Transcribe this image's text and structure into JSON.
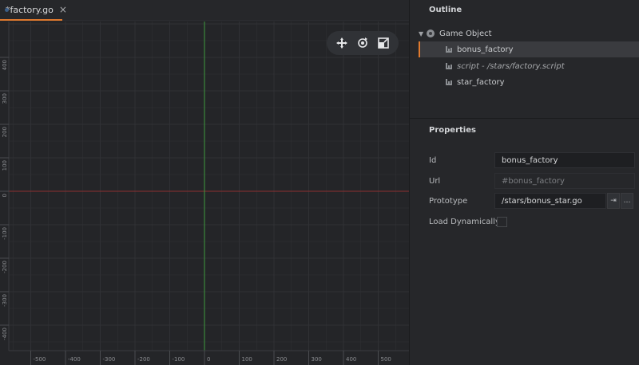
{
  "tab": {
    "title": "*factory.go",
    "close": "×",
    "icon": "game-object-icon"
  },
  "viewport": {
    "x_axis_labels": [
      "-500",
      "-400",
      "-300",
      "-200",
      "-100",
      "0",
      "100",
      "200",
      "300",
      "400",
      "500"
    ],
    "y_axis_labels": [
      "400",
      "300",
      "200",
      "100",
      "0",
      "-100",
      "-200",
      "-300",
      "-400"
    ],
    "colors": {
      "x_axis": "#8b2f2f",
      "y_axis": "#3e9a3e",
      "grid": "#303135"
    }
  },
  "toolbar": {
    "tools": [
      "move-tool-icon",
      "rotate-tool-icon",
      "scale-tool-icon"
    ]
  },
  "outline": {
    "title": "Outline",
    "root": "Game Object",
    "items": [
      {
        "label": "bonus_factory",
        "selected": true
      },
      {
        "label": "script - /stars/factory.script",
        "selected": false
      },
      {
        "label": "star_factory",
        "selected": false
      }
    ]
  },
  "properties": {
    "title": "Properties",
    "id": {
      "label": "Id",
      "value": "bonus_factory"
    },
    "url": {
      "label": "Url",
      "value": "#bonus_factory"
    },
    "prototype": {
      "label": "Prototype",
      "value": "/stars/bonus_star.go",
      "goto": "⇥",
      "browse": "…"
    },
    "load_dynamically": {
      "label": "Load Dynamically",
      "checked": false
    }
  }
}
